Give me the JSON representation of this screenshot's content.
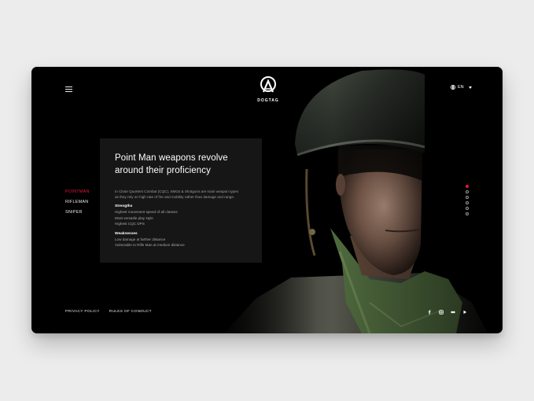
{
  "logo": {
    "text": "DOGTAG"
  },
  "language": {
    "current": "EN"
  },
  "classes": [
    {
      "label": "POINTMAN",
      "active": true
    },
    {
      "label": "RIFLEMAN",
      "active": false
    },
    {
      "label": "SNIPER",
      "active": false
    }
  ],
  "card": {
    "title_line1": "Point Man weapons revolve",
    "title_line2": "around their proficiency",
    "desc_line1": "In Close Quarters Combat (CQC), SMGs & Shotguns are main weapon types",
    "desc_line2": "as they rely on high rate of fire and mobility rather than damage and range.",
    "strengths_heading": "Strengths",
    "strengths": [
      "Highest movement speed of all classes",
      "Most versatile play style",
      "Highest CQC DPS"
    ],
    "weaknesses_heading": "Weaknesses",
    "weaknesses": [
      "Low damage at farther distance",
      "Vulnerable to Rifle Man at medium distance"
    ]
  },
  "pagination": {
    "count": 6,
    "active_index": 0
  },
  "footer": {
    "privacy": "PRIVACY POLICY",
    "rules": "RULES OF CONDUCT"
  },
  "social_icons": [
    "facebook-icon",
    "instagram-icon",
    "flickr-icon",
    "youtube-icon"
  ],
  "colors": {
    "accent": "#e1163c",
    "background": "#000000",
    "card": "#161616",
    "page": "#ececec"
  }
}
